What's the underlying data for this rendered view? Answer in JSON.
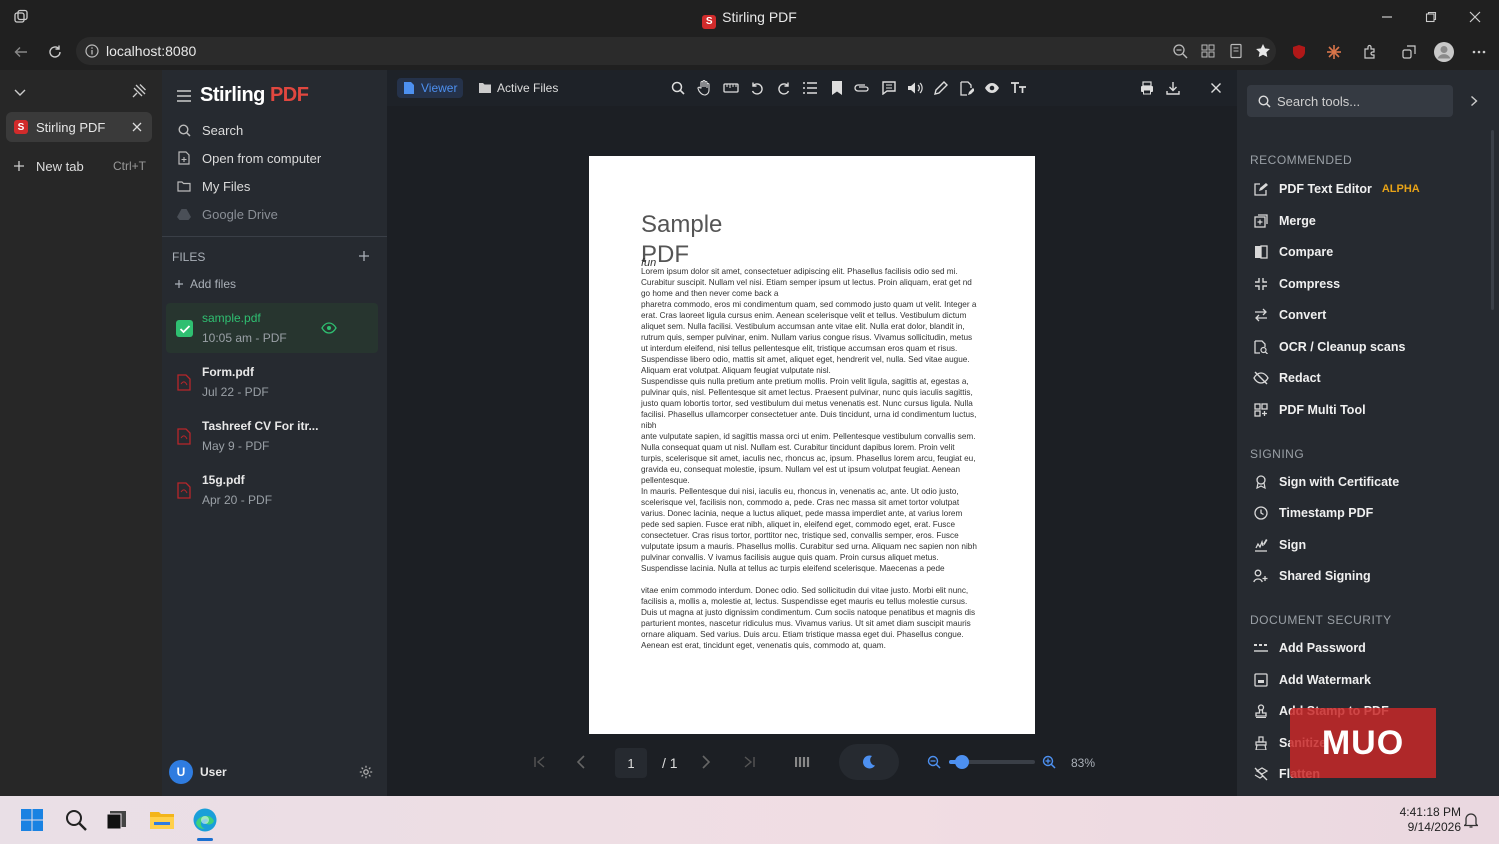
{
  "window": {
    "title": "Stirling PDF"
  },
  "browser": {
    "url": "localhost:8080",
    "tab_title": "Stirling PDF",
    "new_tab_label": "New tab",
    "new_tab_shortcut": "Ctrl+T"
  },
  "app": {
    "brand_main": "Stirling",
    "brand_accent": "PDF",
    "nav": [
      {
        "label": "Search",
        "icon": "search-icon"
      },
      {
        "label": "Open from computer",
        "icon": "file-icon"
      },
      {
        "label": "My Files",
        "icon": "folder-icon"
      },
      {
        "label": "Google Drive",
        "icon": "drive-icon"
      }
    ],
    "files_header": "FILES",
    "add_files": "Add files",
    "files": [
      {
        "name": "sample.pdf",
        "meta": "10:05 am - PDF",
        "selected": true
      },
      {
        "name": "Form.pdf",
        "meta": "Jul 22 - PDF"
      },
      {
        "name": "Tashreef CV For itr...",
        "meta": "May 9 - PDF"
      },
      {
        "name": "15g.pdf",
        "meta": "Apr 20 - PDF"
      }
    ],
    "user": {
      "initial": "U",
      "name": "User"
    }
  },
  "viewer": {
    "tabs": [
      {
        "label": "Viewer",
        "active": true
      },
      {
        "label": "Active Files"
      }
    ],
    "page_title_line1": "Sample",
    "page_title_line2": "PDF",
    "page_subtitle": "fun",
    "paragraphs": [
      "Lorem ipsum dolor sit amet, consectetuer adipiscing elit. Phasellus facilisis odio sed mi. Curabitur suscipit. Nullam vel nisi. Etiam semper ipsum ut lectus. Proin aliquam, erat get nd go home and then never come back a",
      "pharetra commodo, eros mi condimentum quam, sed commodo justo quam ut velit. Integer a erat. Cras laoreet ligula cursus enim. Aenean scelerisque velit et tellus. Vestibulum dictum aliquet sem. Nulla facilisi. Vestibulum accumsan ante vitae elit. Nulla erat dolor, blandit in, rutrum quis, semper pulvinar, enim. Nullam varius congue risus. Vivamus sollicitudin, metus ut interdum eleifend, nisi tellus pellentesque elit, tristique accumsan eros quam et risus. Suspendisse libero odio, mattis sit amet, aliquet eget, hendrerit vel, nulla. Sed vitae augue. Aliquam erat volutpat. Aliquam feugiat vulputate nisl.",
      "Suspendisse quis nulla pretium ante pretium mollis. Proin velit ligula, sagittis at, egestas a, pulvinar quis, nisl. Pellentesque sit amet lectus. Praesent pulvinar, nunc quis iaculis sagittis, justo quam lobortis tortor, sed vestibulum dui metus venenatis est. Nunc cursus ligula. Nulla facilisi. Phasellus ullamcorper consectetuer ante. Duis tincidunt, urna id condimentum luctus, nibh",
      "ante vulputate sapien, id sagittis massa orci ut enim. Pellentesque vestibulum convallis sem. Nulla consequat quam ut nisl. Nullam est. Curabitur tincidunt dapibus lorem. Proin velit turpis, scelerisque sit amet, iaculis nec, rhoncus ac, ipsum. Phasellus lorem arcu, feugiat eu, gravida eu, consequat molestie, ipsum. Nullam vel est ut ipsum volutpat feugiat. Aenean pellentesque.",
      "In mauris. Pellentesque dui nisi, iaculis eu, rhoncus in, venenatis ac, ante. Ut odio justo, scelerisque vel, facilisis non, commodo a, pede. Cras nec massa sit amet tortor volutpat varius. Donec lacinia, neque a luctus aliquet, pede massa imperdiet ante, at varius lorem",
      "pede sed sapien. Fusce erat nibh, aliquet in, eleifend eget, commodo eget, erat. Fusce consectetuer. Cras risus tortor, porttitor nec, tristique sed, convallis semper, eros. Fusce vulputate ipsum a mauris. Phasellus mollis. Curabitur sed urna. Aliquam nec sapien non nibh pulvinar convallis. V   ivamus facilisis augue quis quam. Proin cursus aliquet metus. Suspendisse lacinia. Nulla at tellus ac turpis eleifend scelerisque. Maecenas a pede",
      "vitae enim commodo interdum. Donec odio. Sed sollicitudin dui vitae justo. Morbi elit nunc, facilisis a, mollis a, molestie at, lectus. Suspendisse eget mauris eu tellus molestie cursus. Duis ut magna at justo dignissim condimentum. Cum sociis natoque penatibus et magnis dis parturient montes, nascetur ridiculus mus. Vivamus varius. Ut sit amet diam suscipit mauris ornare aliquam. Sed varius. Duis arcu. Etiam tristique massa eget dui. Phasellus congue. Aenean est erat, tincidunt eget, venenatis quis, commodo at, quam."
    ],
    "current_page": "1",
    "total_pages": "/ 1",
    "zoom_percent": "83%",
    "zoom_level": 0.15
  },
  "tools": {
    "search_placeholder": "Search tools...",
    "sections": [
      {
        "title": "RECOMMENDED",
        "items": [
          {
            "label": "PDF Text Editor",
            "badge": "ALPHA",
            "icon": "edit-icon"
          },
          {
            "label": "Merge",
            "icon": "merge-icon"
          },
          {
            "label": "Compare",
            "icon": "compare-icon"
          },
          {
            "label": "Compress",
            "icon": "compress-icon"
          },
          {
            "label": "Convert",
            "icon": "convert-icon"
          },
          {
            "label": "OCR / Cleanup scans",
            "icon": "ocr-icon"
          },
          {
            "label": "Redact",
            "icon": "redact-icon"
          },
          {
            "label": "PDF Multi Tool",
            "icon": "multitool-icon"
          }
        ]
      },
      {
        "title": "SIGNING",
        "items": [
          {
            "label": "Sign with Certificate",
            "icon": "certificate-icon"
          },
          {
            "label": "Timestamp PDF",
            "icon": "clock-icon"
          },
          {
            "label": "Sign",
            "icon": "sign-icon"
          },
          {
            "label": "Shared Signing",
            "icon": "users-icon"
          }
        ]
      },
      {
        "title": "DOCUMENT SECURITY",
        "items": [
          {
            "label": "Add Password",
            "icon": "password-icon"
          },
          {
            "label": "Add Watermark",
            "icon": "watermark-icon"
          },
          {
            "label": "Add Stamp to PDF",
            "icon": "stamp-icon"
          },
          {
            "label": "Sanitize",
            "icon": "sanitize-icon"
          },
          {
            "label": "Flatten",
            "icon": "flatten-icon"
          }
        ]
      }
    ]
  },
  "watermark": "MUO",
  "taskbar": {
    "time": "4:41:18 PM",
    "date": "9/14/2026"
  },
  "colors": {
    "accent": "#2f7ce0",
    "brand_red": "#e0473f",
    "selected_green": "#2fbf71",
    "alpha": "#e8a317"
  }
}
